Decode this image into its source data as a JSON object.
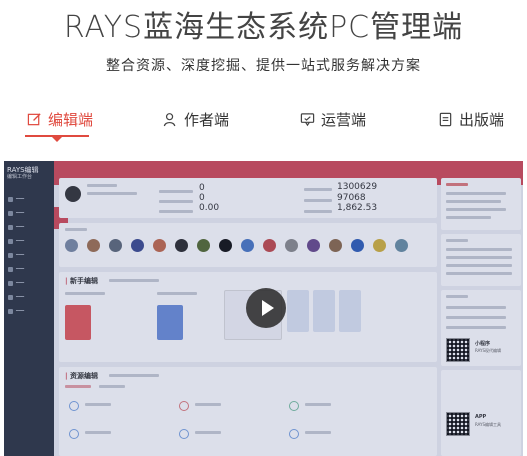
{
  "hero": {
    "title": "RAYS蓝海生态系统PC管理端",
    "subtitle": "整合资源、深度挖掘、提供一站式服务解决方案"
  },
  "tabs": [
    {
      "label": "编辑端",
      "icon": "edit-icon",
      "active": true
    },
    {
      "label": "作者端",
      "icon": "user-icon",
      "active": false
    },
    {
      "label": "运营端",
      "icon": "chat-icon",
      "active": false
    },
    {
      "label": "出版端",
      "icon": "document-icon",
      "active": false
    }
  ],
  "preview": {
    "logo": "RAYS编辑",
    "logo_sub": "编辑工作台",
    "stats": [
      {
        "value": "0"
      },
      {
        "value": "0"
      },
      {
        "value": "0.00"
      },
      {
        "value": "1300629"
      },
      {
        "value": "97068"
      },
      {
        "value": "1,862.53"
      }
    ],
    "sections": {
      "novice": "新手编辑",
      "resource": "资源编辑",
      "mini_program": "小程序",
      "mini_program_desc": "RAYS现代编辑",
      "app": "APP",
      "app_desc": "RAYS编辑工具"
    }
  },
  "colors": {
    "accent": "#e04a3f",
    "topbar": "#d34a56",
    "sidebar": "#2c3440"
  }
}
